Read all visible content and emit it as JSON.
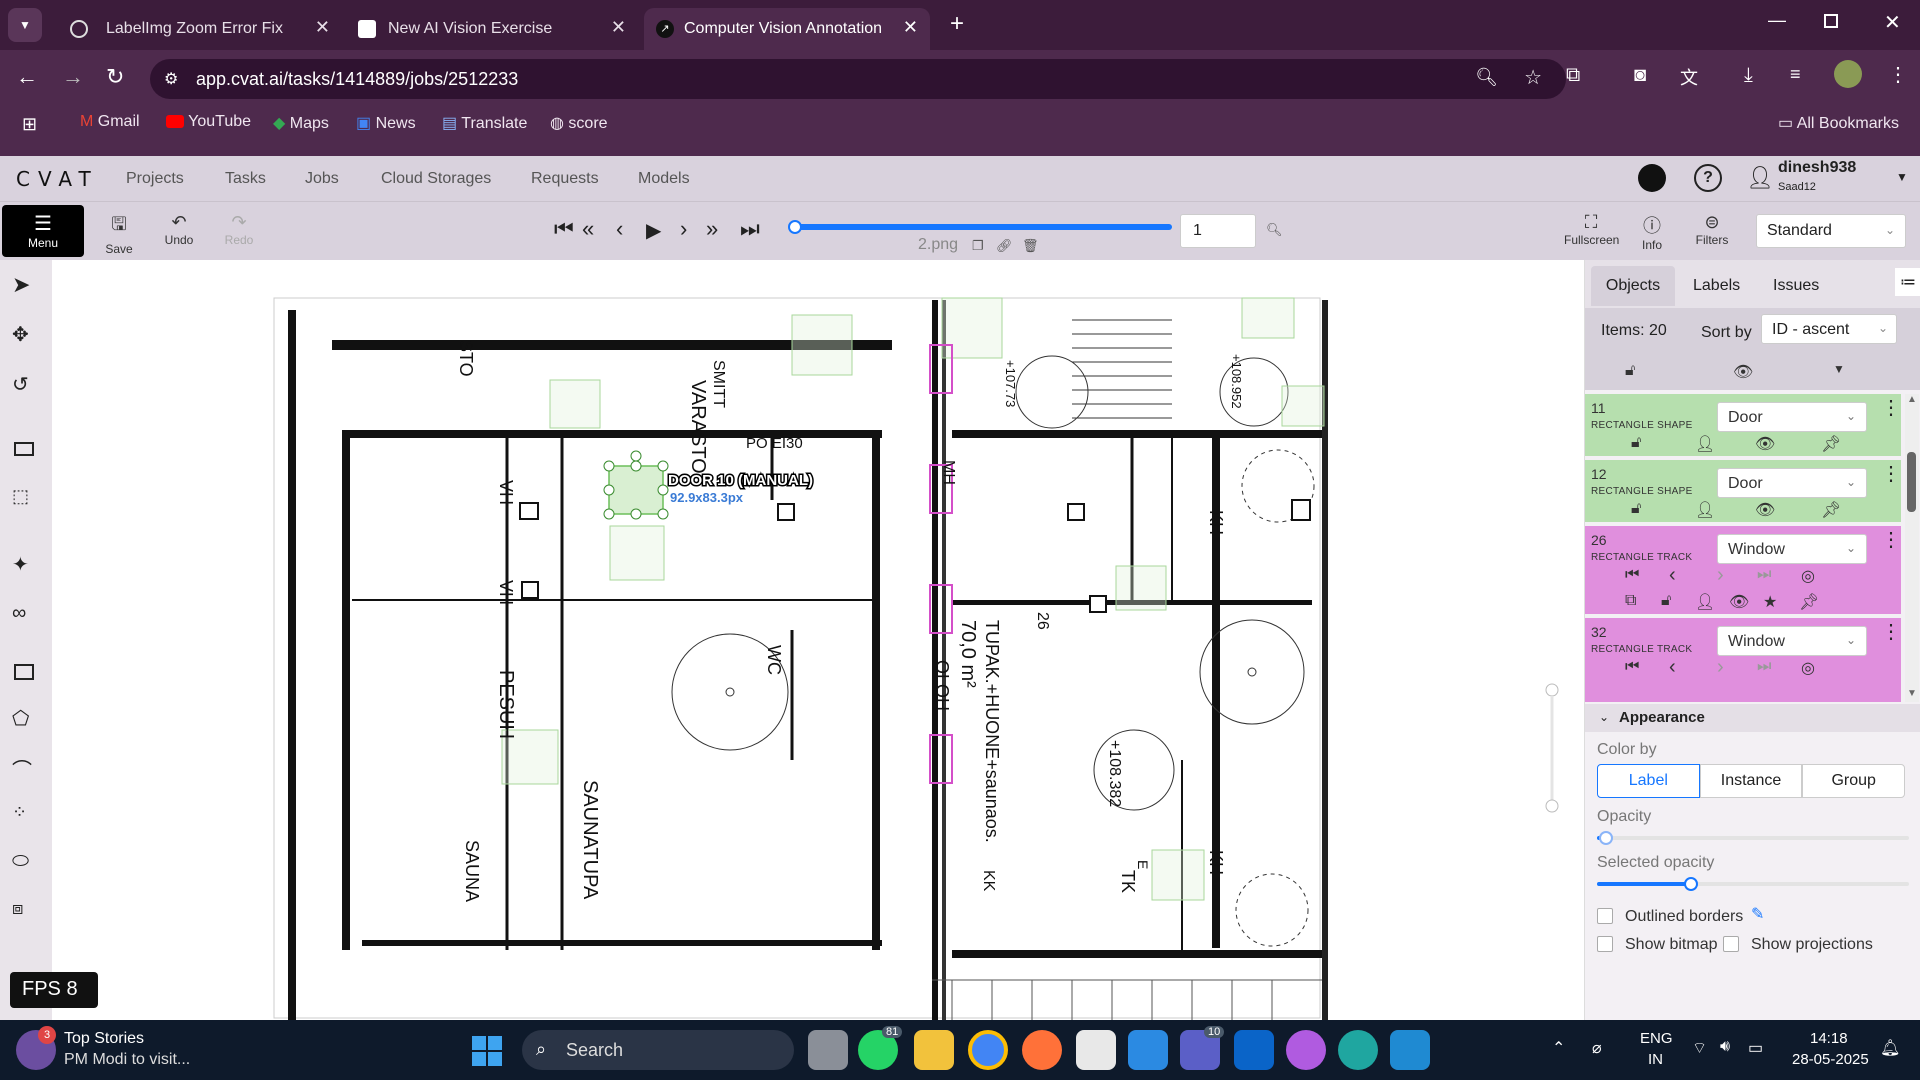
{
  "browser": {
    "tabs": [
      {
        "title": "LabelImg Zoom Error Fix",
        "active": false
      },
      {
        "title": "New AI Vision Exercise",
        "active": false
      },
      {
        "title": "Computer Vision Annotation To",
        "active": true
      }
    ],
    "url": "app.cvat.ai/tasks/1414889/jobs/2512233",
    "bookmarks": [
      "Gmail",
      "YouTube",
      "Maps",
      "News",
      "Translate",
      "score"
    ],
    "all_bookmarks": "All Bookmarks"
  },
  "cvat": {
    "logo": "CVAT",
    "nav": [
      "Projects",
      "Tasks",
      "Jobs",
      "Cloud Storages",
      "Requests",
      "Models"
    ],
    "user": {
      "name": "dinesh938",
      "org": "Saad12"
    },
    "toolbar": {
      "menu": "Menu",
      "save": "Save",
      "undo": "Undo",
      "redo": "Redo",
      "frame": "1",
      "filename": "2.png",
      "fullscreen": "Fullscreen",
      "info": "Info",
      "filters": "Filters",
      "workspace": "Standard"
    },
    "canvas": {
      "label_title": "DOOR 10 (MANUAL)",
      "label_size": "92.9x83.3px",
      "fps": "FPS 8",
      "plan_labels": [
        "VARASTO",
        "VH",
        "VH",
        "STO",
        "SMITT",
        "PO EI30",
        "WC",
        "PESUH",
        "SAUNATUPA",
        "SAUNA",
        "MH",
        "KH",
        "KH",
        "70,0 m²",
        "OLOH",
        "TUPAK.+HUONE+saunaos.",
        "KK",
        "TK",
        "+108.382",
        "+107.73",
        "+108.952",
        "26",
        "E"
      ]
    },
    "panel": {
      "tabs": [
        "Objects",
        "Labels",
        "Issues"
      ],
      "items_count": "Items: 20",
      "sort_by_label": "Sort by",
      "sort_by_value": "ID - ascent",
      "objects": [
        {
          "id": "11",
          "kind": "RECTANGLE SHAPE",
          "label": "Door",
          "color": "#b6dfae"
        },
        {
          "id": "12",
          "kind": "RECTANGLE SHAPE",
          "label": "Door",
          "color": "#b6dfae"
        },
        {
          "id": "26",
          "kind": "RECTANGLE TRACK",
          "label": "Window",
          "color": "#e08fdd"
        },
        {
          "id": "32",
          "kind": "RECTANGLE TRACK",
          "label": "Window",
          "color": "#e08fdd"
        }
      ],
      "appearance": {
        "title": "Appearance",
        "color_by": "Color by",
        "color_options": [
          "Label",
          "Instance",
          "Group"
        ],
        "opacity": "Opacity",
        "opacity_value": 0.03,
        "selected_opacity": "Selected opacity",
        "selected_opacity_value": 0.3,
        "outlined_borders": "Outlined borders",
        "show_bitmap": "Show bitmap",
        "show_projections": "Show projections"
      }
    }
  },
  "taskbar": {
    "news_title": "Top Stories",
    "news_sub": "PM Modi to visit...",
    "news_badge": "3",
    "search": "Search",
    "whatsapp_badge": "81",
    "teams_badge": "10",
    "lang1": "ENG",
    "lang2": "IN",
    "time": "14:18",
    "date": "28-05-2025"
  }
}
